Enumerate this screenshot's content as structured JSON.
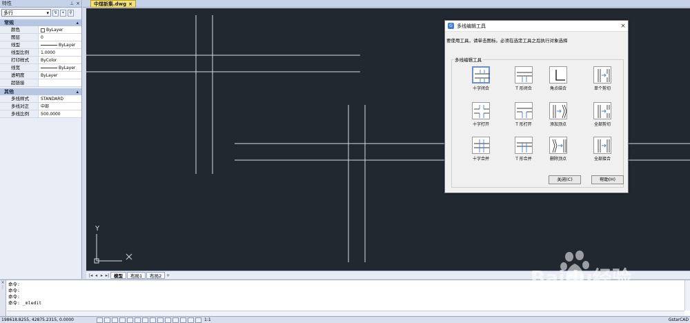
{
  "properties": {
    "title": "特性",
    "selector_value": "多行",
    "sections": [
      {
        "name": "常规",
        "rows": [
          {
            "key": "颜色",
            "value": "ByLayer",
            "kind": "color"
          },
          {
            "key": "图层",
            "value": "0",
            "kind": "text"
          },
          {
            "key": "线型",
            "value": "ByLayer",
            "kind": "line"
          },
          {
            "key": "线型比例",
            "value": "1.0000",
            "kind": "text"
          },
          {
            "key": "打印样式",
            "value": "ByColor",
            "kind": "text"
          },
          {
            "key": "线宽",
            "value": "ByLayer",
            "kind": "line"
          },
          {
            "key": "透明度",
            "value": "ByLayer",
            "kind": "text"
          },
          {
            "key": "超链接",
            "value": "",
            "kind": "text"
          }
        ]
      },
      {
        "name": "其他",
        "rows": [
          {
            "key": "多线样式",
            "value": "STANDARD",
            "kind": "text"
          },
          {
            "key": "多线对正",
            "value": "中部",
            "kind": "text"
          },
          {
            "key": "多线比例",
            "value": "500.0000",
            "kind": "text"
          }
        ]
      }
    ]
  },
  "document_tab": {
    "label": "中煤新集.dwg",
    "close": "×"
  },
  "canvas": {
    "background": "#212830",
    "line_color": "#d8dde3",
    "ucs_x": "X",
    "ucs_y": "Y"
  },
  "layout_tabs": {
    "nav": [
      "|◂",
      "◂",
      "▸",
      "▸|"
    ],
    "tabs": [
      "模型",
      "布局1",
      "布局2"
    ],
    "active": 0,
    "add": "+"
  },
  "dialog": {
    "title": "多线编辑工具",
    "close": "×",
    "instruction": "要使用工具，请单击图标。必须在选定工具之后执行对象选择",
    "group_label": "多线编辑工具",
    "tools": [
      {
        "label": "十字闭合",
        "icon": "cross-closed-icon"
      },
      {
        "label": "T 形闭合",
        "icon": "tee-closed-icon"
      },
      {
        "label": "角点结合",
        "icon": "corner-joint-icon"
      },
      {
        "label": "单个剪切",
        "icon": "cut-single-icon"
      },
      {
        "label": "十字打开",
        "icon": "cross-open-icon"
      },
      {
        "label": "T 形打开",
        "icon": "tee-open-icon"
      },
      {
        "label": "添加顶点",
        "icon": "add-vertex-icon"
      },
      {
        "label": "全部剪切",
        "icon": "cut-all-icon"
      },
      {
        "label": "十字合并",
        "icon": "cross-merged-icon"
      },
      {
        "label": "T 形合并",
        "icon": "tee-merged-icon"
      },
      {
        "label": "删除顶点",
        "icon": "delete-vertex-icon"
      },
      {
        "label": "全部接合",
        "icon": "weld-all-icon"
      }
    ],
    "selected_tool": 0,
    "close_button": "关闭(C)",
    "help_button": "帮助(H)"
  },
  "command": {
    "lines": [
      "命令:",
      "命令:",
      "命令:",
      "命令: _mledit"
    ]
  },
  "status": {
    "coords": "198618.8255, 42875.2315, 0.0000",
    "scale": "1:1",
    "brand": "GstarCAD"
  },
  "watermark": {
    "text": "Baidu经验",
    "sub": "jingyan.baidu.com"
  }
}
